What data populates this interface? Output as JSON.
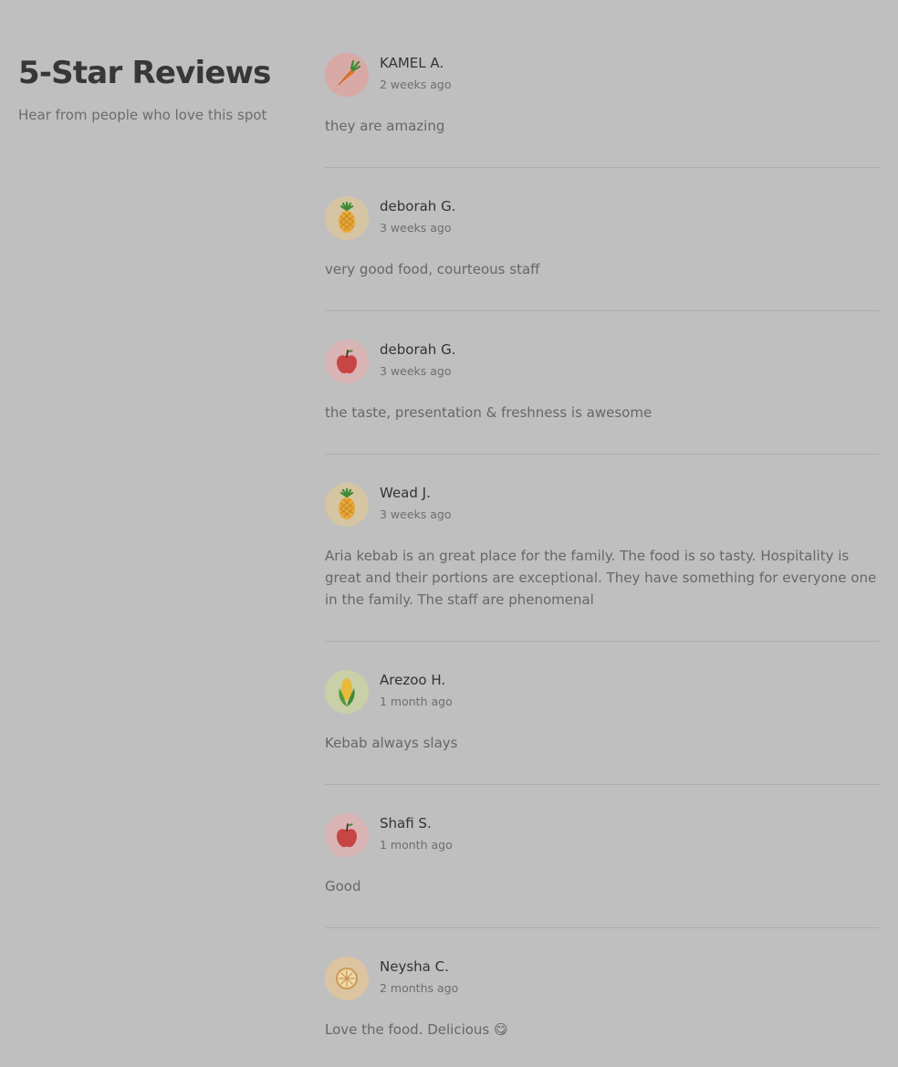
{
  "section": {
    "title": "5-Star Reviews",
    "subtitle": "Hear from people who love this spot"
  },
  "reviews": [
    {
      "name": "KAMEL A.",
      "time": "2 weeks ago",
      "text": "they are amazing",
      "avatar_icon": "carrot-icon",
      "avatar_bg": "#d9a9a6"
    },
    {
      "name": "deborah G.",
      "time": "3 weeks ago",
      "text": "very good food, courteous staff",
      "avatar_icon": "pineapple-icon",
      "avatar_bg": "#d6c5a3"
    },
    {
      "name": "deborah G.",
      "time": "3 weeks ago",
      "text": "the taste, presentation & freshness is awesome",
      "avatar_icon": "apple-icon",
      "avatar_bg": "#d9b4b4"
    },
    {
      "name": "Wead J.",
      "time": "3 weeks ago",
      "text": "Aria kebab is an great place for the family. The food is so tasty. Hospitality is great and their portions are exceptional. They have something for everyone one in the family. The staff are phenomenal",
      "avatar_icon": "pineapple-icon",
      "avatar_bg": "#d6c5a3"
    },
    {
      "name": "Arezoo H.",
      "time": "1 month ago",
      "text": "Kebab always slays",
      "avatar_icon": "corn-icon",
      "avatar_bg": "#c9cfa6"
    },
    {
      "name": "Shafi S.",
      "time": "1 month ago",
      "text": "Good",
      "avatar_icon": "apple-icon",
      "avatar_bg": "#d9b4b4"
    },
    {
      "name": "Neysha C.",
      "time": "2 months ago",
      "text": "Love the food. Delicious 😋",
      "avatar_icon": "orange-slice-icon",
      "avatar_bg": "#dcc4a0"
    }
  ]
}
